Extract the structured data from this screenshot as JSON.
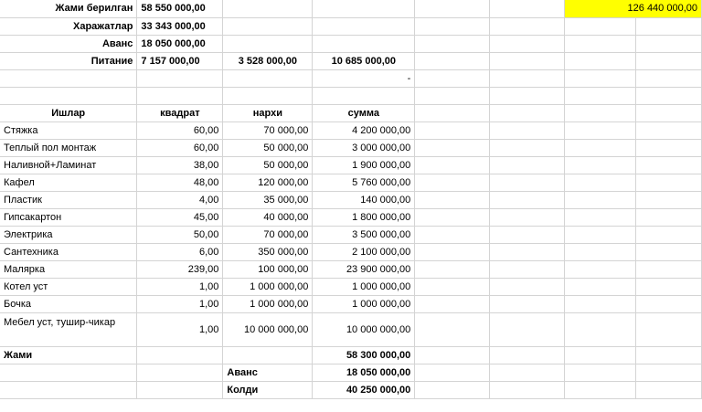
{
  "summary": {
    "total_received": {
      "label": "Жами берилган",
      "value": "58 550 000,00"
    },
    "expenses": {
      "label": "Харажатлар",
      "value": "33 343 000,00"
    },
    "advance": {
      "label": "Аванс",
      "value": "18 050 000,00"
    },
    "food": {
      "label": "Питание",
      "values": [
        "7 157 000,00",
        "3 528 000,00",
        "10 685 000,00"
      ]
    },
    "highlight_value": "126 440 000,00",
    "dash": "-"
  },
  "table": {
    "headers": [
      "Ишлар",
      "квадрат",
      "нархи",
      "сумма"
    ],
    "rows": [
      [
        "Стяжка",
        "60,00",
        "70 000,00",
        "4 200 000,00"
      ],
      [
        "Теплый пол монтаж",
        "60,00",
        "50 000,00",
        "3 000 000,00"
      ],
      [
        "Наливной+Ламинат",
        "38,00",
        "50 000,00",
        "1 900 000,00"
      ],
      [
        "Кафел",
        "48,00",
        "120 000,00",
        "5 760 000,00"
      ],
      [
        "Пластик",
        "4,00",
        "35 000,00",
        "140 000,00"
      ],
      [
        "Гипсакартон",
        "45,00",
        "40 000,00",
        "1 800 000,00"
      ],
      [
        "Электрика",
        "50,00",
        "70 000,00",
        "3 500 000,00"
      ],
      [
        "Сантехника",
        "6,00",
        "350 000,00",
        "2 100 000,00"
      ],
      [
        "Малярка",
        "239,00",
        "100 000,00",
        "23 900 000,00"
      ],
      [
        "Котел уст",
        "1,00",
        "1 000 000,00",
        "1 000 000,00"
      ],
      [
        "Бочка",
        "1,00",
        "1 000 000,00",
        "1 000 000,00"
      ],
      [
        "Мебел уст, тушир-чикар",
        "1,00",
        "10 000 000,00",
        "10 000 000,00"
      ]
    ],
    "total": {
      "label": "Жами",
      "value": "58 300 000,00"
    },
    "advance": {
      "label": "Аванс",
      "value": "18 050 000,00"
    },
    "remaining": {
      "label": "Колди",
      "value": "40 250 000,00"
    }
  },
  "colors": {
    "highlight": "#ffff00",
    "gridline": "#d4d4d4"
  }
}
